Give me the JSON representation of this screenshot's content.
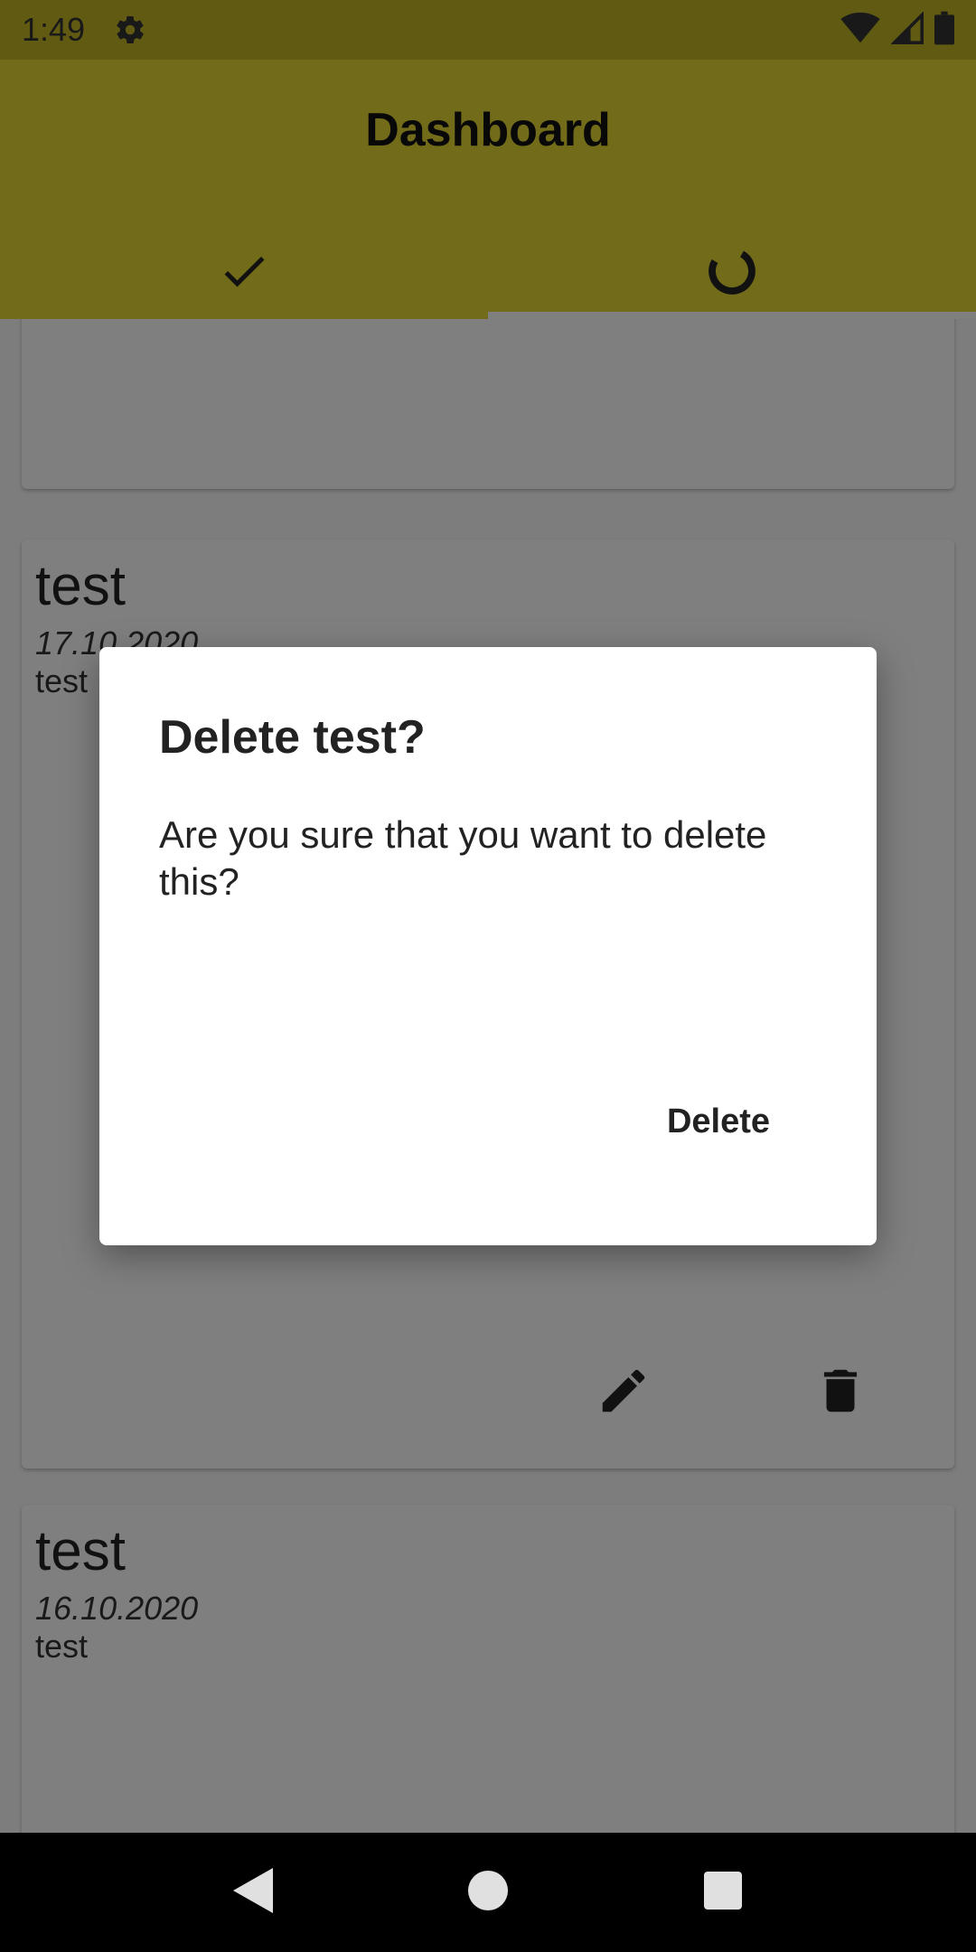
{
  "status_bar": {
    "time": "1:49"
  },
  "app_bar": {
    "title": "Dashboard",
    "tabs": [
      {
        "icon": "check-icon",
        "selected": false
      },
      {
        "icon": "progress-ring-icon",
        "selected": true
      }
    ]
  },
  "cards": [
    {
      "title": "",
      "date": "",
      "description": ""
    },
    {
      "title": "test",
      "date": "17.10.2020",
      "description": "test"
    },
    {
      "title": "test",
      "date": "16.10.2020",
      "description": "test"
    }
  ],
  "dialog": {
    "title": "Delete test?",
    "message": "Are you sure that you want to delete this?",
    "delete_label": "Delete"
  },
  "colors": {
    "app_bar": "#e5d632",
    "status_bar": "#c2b424",
    "scrim": "rgba(0,0,0,0.5)"
  }
}
